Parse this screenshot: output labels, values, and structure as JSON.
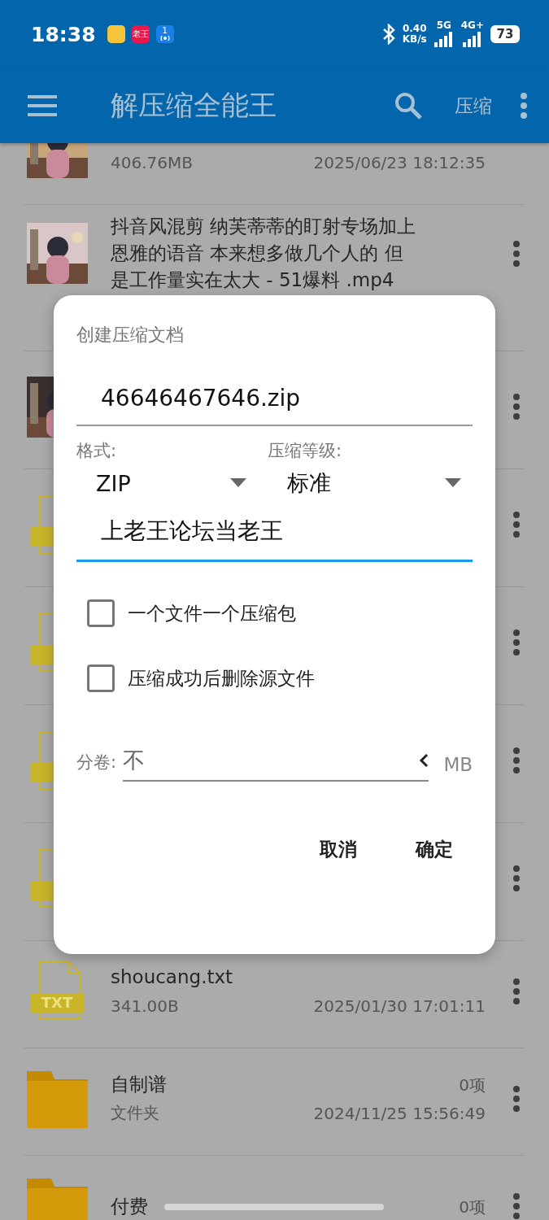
{
  "status_bar": {
    "time": "18:38",
    "notifications": [
      {
        "kind": "note"
      },
      {
        "kind": "badge",
        "label": "老王"
      },
      {
        "kind": "broadcast",
        "label": "1"
      }
    ],
    "speed": "0.40",
    "speed_unit": "KB/s",
    "network_1": "5G",
    "network_2": "4G+",
    "battery": "73"
  },
  "app_bar": {
    "title": "解压缩全能王",
    "action": "压缩"
  },
  "files": [
    {
      "kind": "video",
      "size": "406.76MB",
      "date": "2025/06/23 18:12:35",
      "menu": false
    },
    {
      "kind": "video",
      "title": "抖音风混剪 纳芙蒂蒂的盯射专场加上恩雅的语音 本来想多做几个人的 但是工作量实在太大 - 51爆料 .mp4",
      "menu": true
    },
    {
      "kind": "video",
      "menu": true
    },
    {
      "kind": "txt",
      "menu": true
    },
    {
      "kind": "txt",
      "menu": true
    },
    {
      "kind": "txt",
      "menu": true
    },
    {
      "kind": "txt",
      "menu": true
    },
    {
      "kind": "txt",
      "badge": "TXT",
      "title": "shoucang.txt",
      "size": "341.00B",
      "date": "2025/01/30 17:01:11",
      "menu": true
    },
    {
      "kind": "folder",
      "title": "自制谱",
      "count": "0项",
      "size": "文件夹",
      "date": "2024/11/25 15:56:49",
      "menu": true
    },
    {
      "kind": "folder",
      "title": "付费",
      "count": "0项",
      "menu": true
    }
  ],
  "dialog": {
    "title": "创建压缩文档",
    "filename": "46646467646.zip",
    "format": {
      "label": "格式:",
      "value": "ZIP"
    },
    "level": {
      "label": "压缩等级:",
      "value": "标准"
    },
    "password": {
      "value": "上老王论坛当老王",
      "focused": true
    },
    "options": [
      {
        "label": "一个文件一个压缩包",
        "checked": false
      },
      {
        "label": "压缩成功后删除源文件",
        "checked": false
      }
    ],
    "split": {
      "label": "分卷:",
      "value": "不",
      "unit": "MB"
    },
    "buttons": [
      "取消",
      "确定"
    ]
  }
}
